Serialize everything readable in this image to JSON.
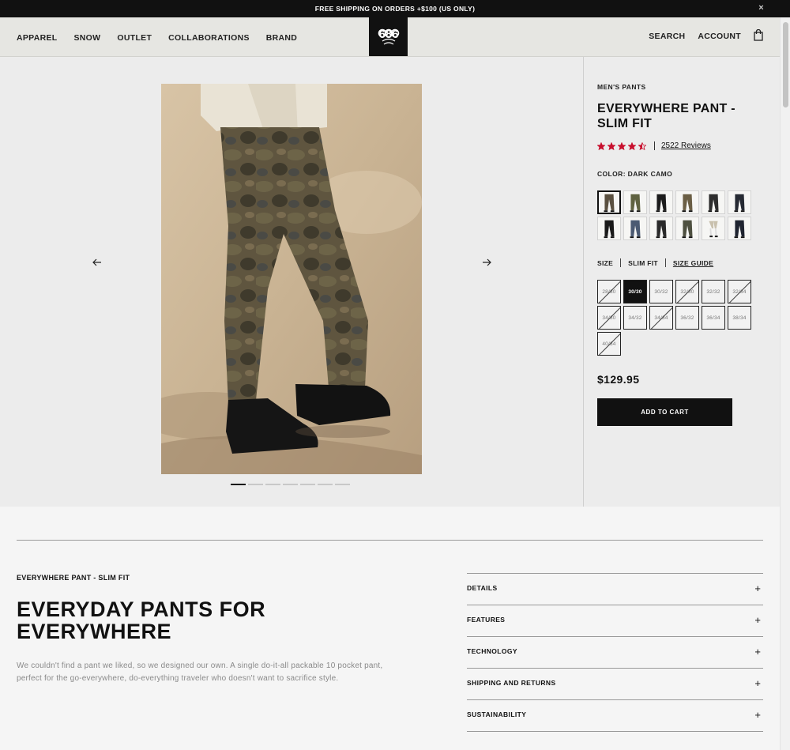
{
  "promo": {
    "text": "FREE SHIPPING ON ORDERS +$100 (US ONLY)",
    "close": "×"
  },
  "header": {
    "nav": [
      "APPAREL",
      "SNOW",
      "OUTLET",
      "COLLABORATIONS",
      "BRAND"
    ],
    "logo": "686",
    "search": "SEARCH",
    "account": "ACCOUNT",
    "cart_icon": "bag-icon"
  },
  "gallery": {
    "slide_count": 7,
    "active_slide": 1,
    "prev_icon": "arrow-left-icon",
    "next_icon": "arrow-right-icon"
  },
  "product": {
    "category": "MEN'S PANTS",
    "title": "EVERYWHERE PANT - SLIM FIT",
    "rating": 4.5,
    "star_color": "#c8102e",
    "reviews": "2522 Reviews",
    "color_label": "COLOR: DARK CAMO",
    "swatch_count": 12,
    "selected_swatch": 0,
    "size_label": "SIZE",
    "fit_label": "SLIM FIT",
    "size_guide": "SIZE GUIDE",
    "sizes": [
      {
        "label": "28/30",
        "state": "sold"
      },
      {
        "label": "30/30",
        "state": "selected"
      },
      {
        "label": "30/32",
        "state": "available"
      },
      {
        "label": "32/30",
        "state": "sold"
      },
      {
        "label": "32/32",
        "state": "available"
      },
      {
        "label": "32/34",
        "state": "sold"
      },
      {
        "label": "34/30",
        "state": "sold"
      },
      {
        "label": "34/32",
        "state": "available"
      },
      {
        "label": "34/34",
        "state": "sold"
      },
      {
        "label": "36/32",
        "state": "available"
      },
      {
        "label": "36/34",
        "state": "available"
      },
      {
        "label": "38/34",
        "state": "available"
      },
      {
        "label": "40/34",
        "state": "sold"
      }
    ],
    "price": "$129.95",
    "add_to_cart": "ADD TO CART"
  },
  "details": {
    "subtitle": "EVERYWHERE PANT - SLIM FIT",
    "headline": "EVERYDAY PANTS FOR EVERYWHERE",
    "description": "We couldn't find a pant we liked, so we designed our own. A single do-it-all packable 10 pocket pant, perfect for the go-everywhere, do-everything traveler who doesn't want to sacrifice style.",
    "accordion": [
      "DETAILS",
      "FEATURES",
      "TECHNOLOGY",
      "SHIPPING AND RETURNS",
      "SUSTAINABILITY"
    ],
    "expand_symbol": "+"
  }
}
